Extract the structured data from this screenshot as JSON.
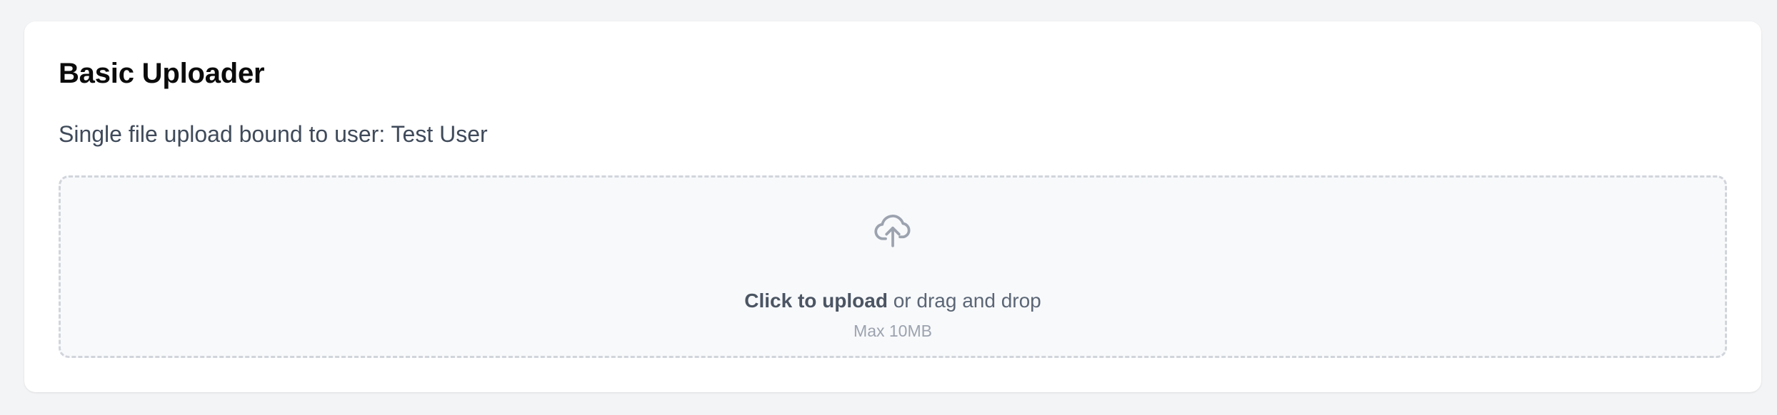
{
  "uploader": {
    "title": "Basic Uploader",
    "subtitle": "Single file upload bound to user: Test User",
    "dropzone": {
      "icon": "cloud-upload-icon",
      "cta_strong": "Click to upload",
      "cta_rest": " or drag and drop",
      "limit": "Max 10MB"
    }
  },
  "colors": {
    "page_background": "#f3f4f6",
    "card_background": "#ffffff",
    "dropzone_background": "#f8f9fb",
    "dropzone_border": "#d1d5db",
    "icon": "#9ca3af"
  }
}
